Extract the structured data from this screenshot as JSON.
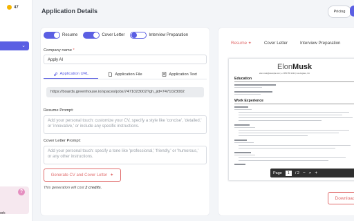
{
  "sidebar": {
    "credits": "47",
    "bottom_label": "ork",
    "help_icon": "?"
  },
  "header": {
    "title": "Application Details",
    "pricing_label": "Pricing"
  },
  "toggles": [
    {
      "label": "Resume",
      "on": true
    },
    {
      "label": "Cover Letter",
      "on": true
    },
    {
      "label": "Interview Preparation",
      "on": false
    }
  ],
  "form": {
    "company_label": "Company name",
    "company_required": "*",
    "company_value": "Apply AI",
    "tabs": [
      {
        "label": "Application URL",
        "active": true
      },
      {
        "label": "Application File",
        "active": false
      },
      {
        "label": "Application Text",
        "active": false
      }
    ],
    "url_value": "https://boards.greenhouse.io/spaces/jobs/7471023002?gh_jid=7471023002",
    "resume_prompt_label": "Resume Prompt:",
    "resume_prompt_placeholder": "Add your personal touch: customize your CV, specify a style like 'concise', 'detailed,' or 'innovative,' or include any specific instructions.",
    "cover_prompt_label": "Cover Letter Prompt:",
    "cover_prompt_placeholder": "Add your personal touch: specify a tone like 'professional,' 'friendly,' or 'humorous,' or any other instructions.",
    "generate_label": "Generate CV and Cover Letter",
    "cost_prefix": "This generation will cost ",
    "cost_amount": "2 credits",
    "cost_suffix": "."
  },
  "preview": {
    "tabs": [
      {
        "label": "Resume",
        "active": true
      },
      {
        "label": "Cover Letter",
        "active": false
      },
      {
        "label": "Interview Preparation",
        "active": false
      }
    ],
    "cv_first_name": "Elon",
    "cv_last_name": "Musk",
    "cv_contact": "elon.musk@example.com  |  +1 555 555 1234  |  Los Angeles, CA",
    "education_heading": "Education",
    "experience_heading": "Work Experience",
    "pdf_page_label": "Page",
    "pdf_page_value": "1",
    "pdf_page_total": "/ 2",
    "download_label": "Download"
  },
  "colors": {
    "accent": "#5b5fe3",
    "danger": "#e06a6a",
    "credit": "#f5b400"
  }
}
